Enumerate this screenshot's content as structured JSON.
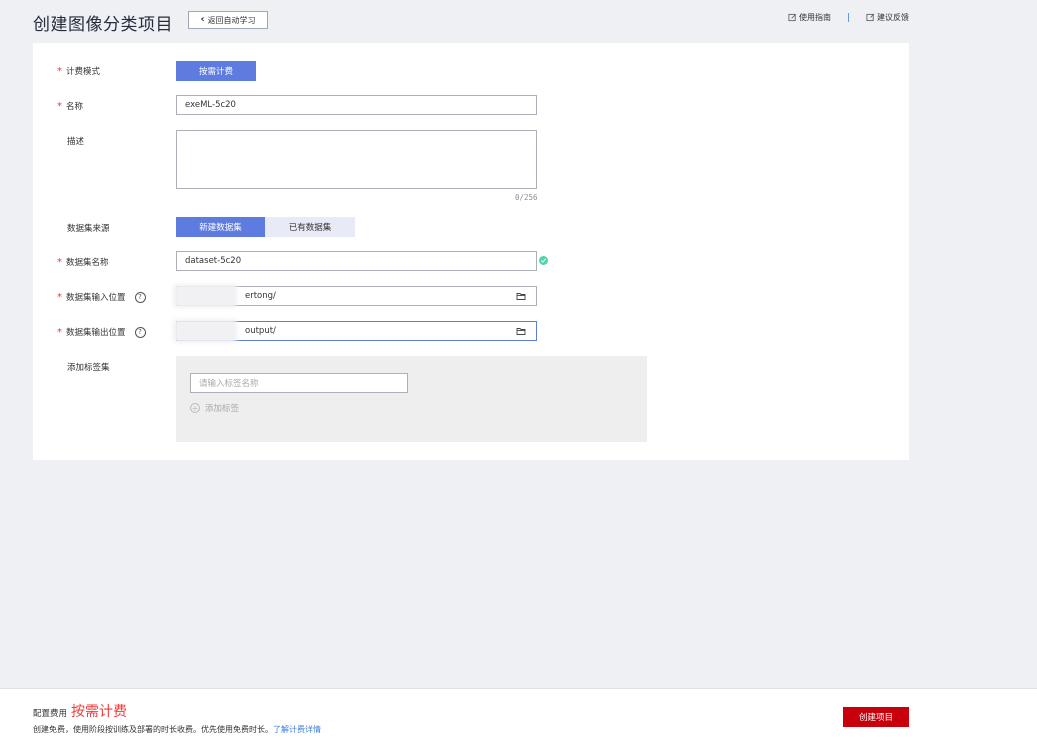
{
  "header": {
    "title": "创建图像分类项目",
    "back_label": "返回自动学习",
    "guide_label": "使用指南",
    "feedback_label": "建议反馈",
    "separator": "|"
  },
  "form": {
    "billing": {
      "label": "计费模式",
      "value": "按需计费"
    },
    "name": {
      "label": "名称",
      "value": "exeML-5c20"
    },
    "description": {
      "label": "描述",
      "value": "",
      "counter": "0/256"
    },
    "dataset_source": {
      "label": "数据集来源",
      "options": [
        "新建数据集",
        "已有数据集"
      ],
      "selected": "新建数据集"
    },
    "dataset_name": {
      "label": "数据集名称",
      "value": "dataset-5c20"
    },
    "input_location": {
      "label": "数据集输入位置",
      "value": "ertong/"
    },
    "output_location": {
      "label": "数据集输出位置",
      "value": "output/"
    },
    "label_set": {
      "label": "添加标签集",
      "placeholder": "请输入标签名称",
      "add_label": "添加标签"
    }
  },
  "footer": {
    "fee_label": "配置费用",
    "fee_value": "按需计费",
    "description": "创建免费，使用阶段按训练及部署的时长收费。优先使用免费时长。",
    "link": "了解计费详情",
    "create_label": "创建项目"
  },
  "colors": {
    "accent": "#5e7ce0",
    "required": "#f03b3b",
    "primary_action": "#c7000b",
    "success": "#50d4ab"
  }
}
